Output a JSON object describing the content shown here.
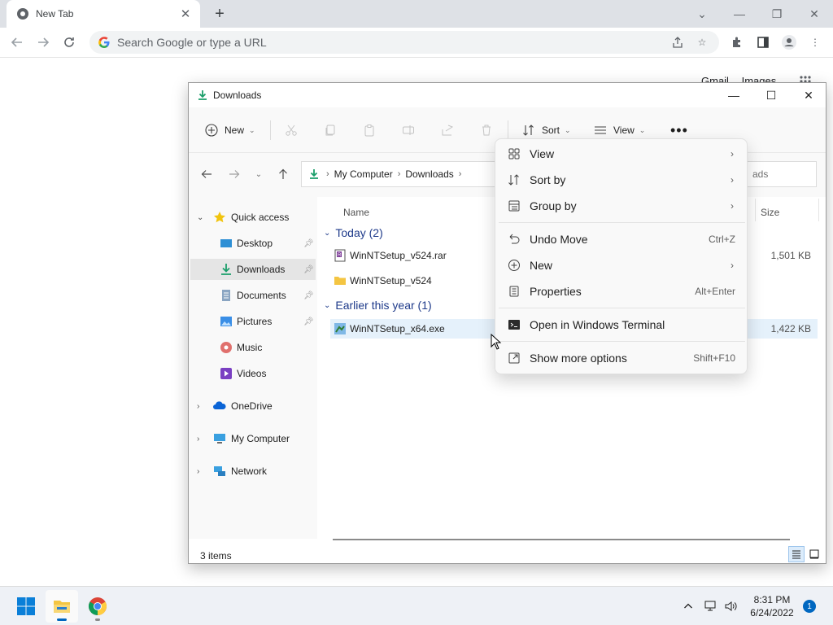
{
  "browser": {
    "tab_title": "New Tab",
    "omnibox_placeholder": "Search Google or type a URL",
    "header_links": {
      "gmail": "Gmail",
      "images": "Images"
    }
  },
  "explorer": {
    "window_title": "Downloads",
    "commands": {
      "new_label": "New",
      "sort_label": "Sort",
      "view_label": "View"
    },
    "breadcrumb": [
      "My Computer",
      "Downloads"
    ],
    "search_placeholder": "Search Downloads",
    "search_visible_fragment": "ads",
    "nav": {
      "quick_access": "Quick access",
      "desktop": "Desktop",
      "downloads": "Downloads",
      "documents": "Documents",
      "pictures": "Pictures",
      "music": "Music",
      "videos": "Videos",
      "onedrive": "OneDrive",
      "my_computer": "My Computer",
      "network": "Network"
    },
    "columns": {
      "name": "Name",
      "size": "Size"
    },
    "groups": [
      {
        "title": "Today (2)",
        "files": [
          {
            "name": "WinNTSetup_v524.rar",
            "size": "1,501 KB"
          },
          {
            "name": "WinNTSetup_v524",
            "size": ""
          }
        ]
      },
      {
        "title": "Earlier this year (1)",
        "files": [
          {
            "name": "WinNTSetup_x64.exe",
            "size": "1,422 KB"
          }
        ]
      }
    ],
    "status": "3 items"
  },
  "context_menu": {
    "view": "View",
    "sort_by": "Sort by",
    "group_by": "Group by",
    "undo_move": "Undo Move",
    "undo_move_key": "Ctrl+Z",
    "new": "New",
    "properties": "Properties",
    "properties_key": "Alt+Enter",
    "open_terminal": "Open in Windows Terminal",
    "show_more": "Show more options",
    "show_more_key": "Shift+F10"
  },
  "taskbar": {
    "time": "8:31 PM",
    "date": "6/24/2022",
    "notifications": "1"
  },
  "colors": {
    "accent": "#0067c0",
    "group_header": "#1e3a8a",
    "selected_row": "#e5f1fb"
  }
}
